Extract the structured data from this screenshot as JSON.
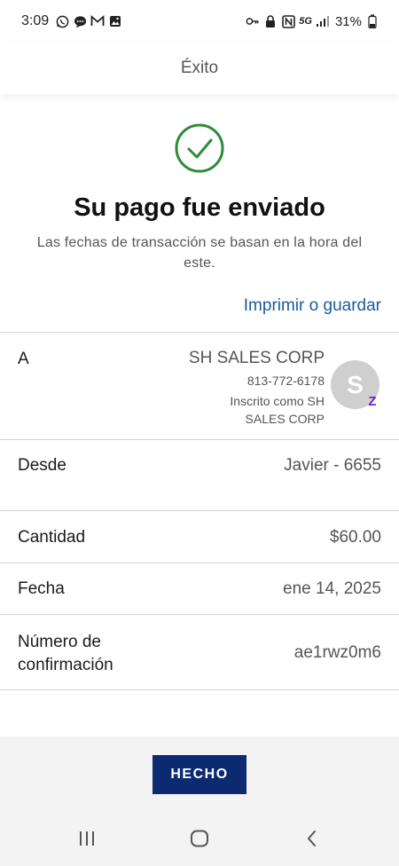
{
  "status_bar": {
    "time": "3:09",
    "network": "5G",
    "battery": "31%",
    "icons": [
      "whatsapp-icon",
      "message-icon",
      "gmail-icon",
      "gallery-icon",
      "key-icon",
      "lock-icon",
      "nfc-icon",
      "signal-icon",
      "battery-icon"
    ]
  },
  "header": {
    "title": "Éxito"
  },
  "success": {
    "title": "Su pago fue enviado",
    "subtitle": "Las fechas de transacción se basan en la hora del este.",
    "icon": "check-circle-icon",
    "color": "#2e8b3a"
  },
  "print_link": "Imprimir o guardar",
  "details": {
    "to": {
      "label": "A",
      "name": "SH SALES CORP",
      "phone": "813-772-6178",
      "enrolled": "Inscrito como SH SALES CORP",
      "avatar_initial": "S",
      "badge": "Z"
    },
    "from": {
      "label": "Desde",
      "value": "Javier - 6655"
    },
    "amount": {
      "label": "Cantidad",
      "value": "$60.00"
    },
    "date": {
      "label": "Fecha",
      "value": "ene 14, 2025"
    },
    "confirmation": {
      "label": "Número de confirmación",
      "value": "ae1rwz0m6"
    }
  },
  "done_button": "HECHO",
  "nav": {
    "icons": [
      "recent-apps-icon",
      "home-icon",
      "back-icon"
    ]
  },
  "colors": {
    "link": "#1a5b9c",
    "button": "#0b2a6f",
    "zelle": "#6d1ed4"
  }
}
